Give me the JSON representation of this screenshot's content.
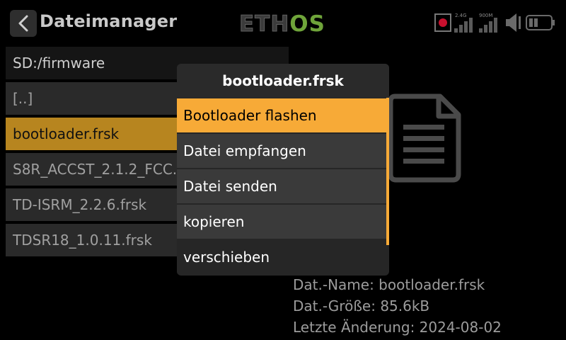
{
  "header": {
    "title": "Dateimanager",
    "brand": "ETHOS",
    "radio_24_label": "2.4G",
    "radio_900_label": "900M"
  },
  "list": {
    "path": "SD:/firmware",
    "items": [
      {
        "label": "[..]"
      },
      {
        "label": "bootloader.frsk"
      },
      {
        "label": "S8R_ACCST_2.1.2_FCC.frsk"
      },
      {
        "label": "TD-ISRM_2.2.6.frsk"
      },
      {
        "label": "TDSR18_1.0.11.frsk"
      }
    ]
  },
  "menu": {
    "title": "bootloader.frsk",
    "items": [
      {
        "label": "Bootloader flashen"
      },
      {
        "label": "Datei empfangen"
      },
      {
        "label": "Datei senden"
      },
      {
        "label": "kopieren"
      },
      {
        "label": "verschieben"
      }
    ]
  },
  "info": {
    "name": "Dat.-Name: bootloader.frsk",
    "size": "Dat.-Größe: 85.6kB",
    "modified": "Letzte Änderung: 2024-08-02"
  },
  "colors": {
    "accent": "#f7aa37",
    "selected_row": "#b7851f",
    "brand_green": "#6fa43a"
  }
}
